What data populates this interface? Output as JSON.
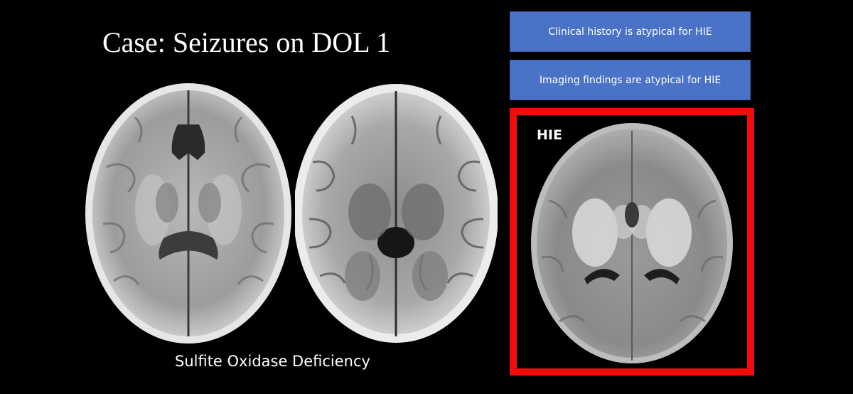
{
  "slide": {
    "title": "Case: Seizures on DOL 1",
    "caption": "Sulfite Oxidase Deficiency",
    "options": [
      {
        "label": "Clinical history is atypical for HIE"
      },
      {
        "label": "Imaging findings are atypical for HIE"
      }
    ],
    "answer_label": "HIE"
  },
  "colors": {
    "background": "#000000",
    "option_button": "#4a72c6",
    "answer_border": "#f20d0d",
    "text": "#ffffff"
  },
  "icons": [
    "mri-axial-brain-image-1",
    "mri-axial-brain-image-2",
    "mri-axial-brain-image-hie"
  ]
}
